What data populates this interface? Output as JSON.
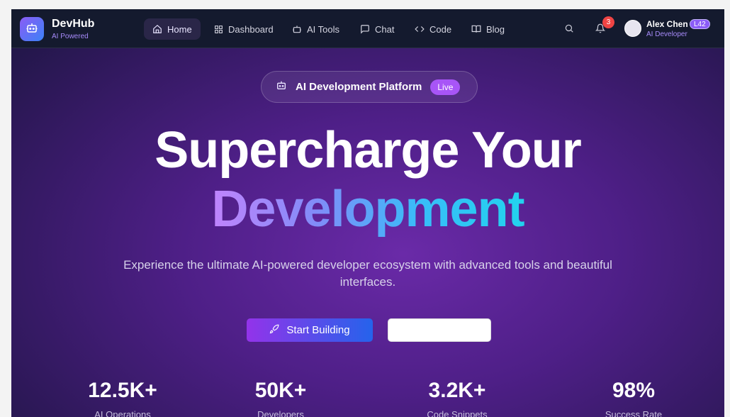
{
  "nav": {
    "brand": "DevHub",
    "brand_sub": "AI Powered",
    "items": [
      {
        "label": "Home",
        "icon": "home-icon"
      },
      {
        "label": "Dashboard",
        "icon": "dashboard-icon"
      },
      {
        "label": "AI Tools",
        "icon": "robot-icon"
      },
      {
        "label": "Chat",
        "icon": "chat-icon"
      },
      {
        "label": "Code",
        "icon": "code-icon"
      },
      {
        "label": "Blog",
        "icon": "book-icon"
      }
    ],
    "notification_count": "3",
    "user": {
      "name": "Alex Chen",
      "level": "L42",
      "role": "AI Developer"
    }
  },
  "hero": {
    "pill_text": "AI Development Platform",
    "pill_badge": "Live",
    "title_line1": "Supercharge Your",
    "title_line2": "Development",
    "lead": "Experience the ultimate AI-powered developer ecosystem with advanced tools and beautiful interfaces.",
    "primary_button": "Start Building",
    "secondary_button": ""
  },
  "stats": [
    {
      "value": "12.5K+",
      "label": "AI Operations"
    },
    {
      "value": "50K+",
      "label": "Developers"
    },
    {
      "value": "3.2K+",
      "label": "Code Snippets"
    },
    {
      "value": "98%",
      "label": "Success Rate"
    }
  ],
  "colors": {
    "accent": "#8b5cf6",
    "brand_sub": "#a78bfa",
    "badge": "#ef4444"
  }
}
